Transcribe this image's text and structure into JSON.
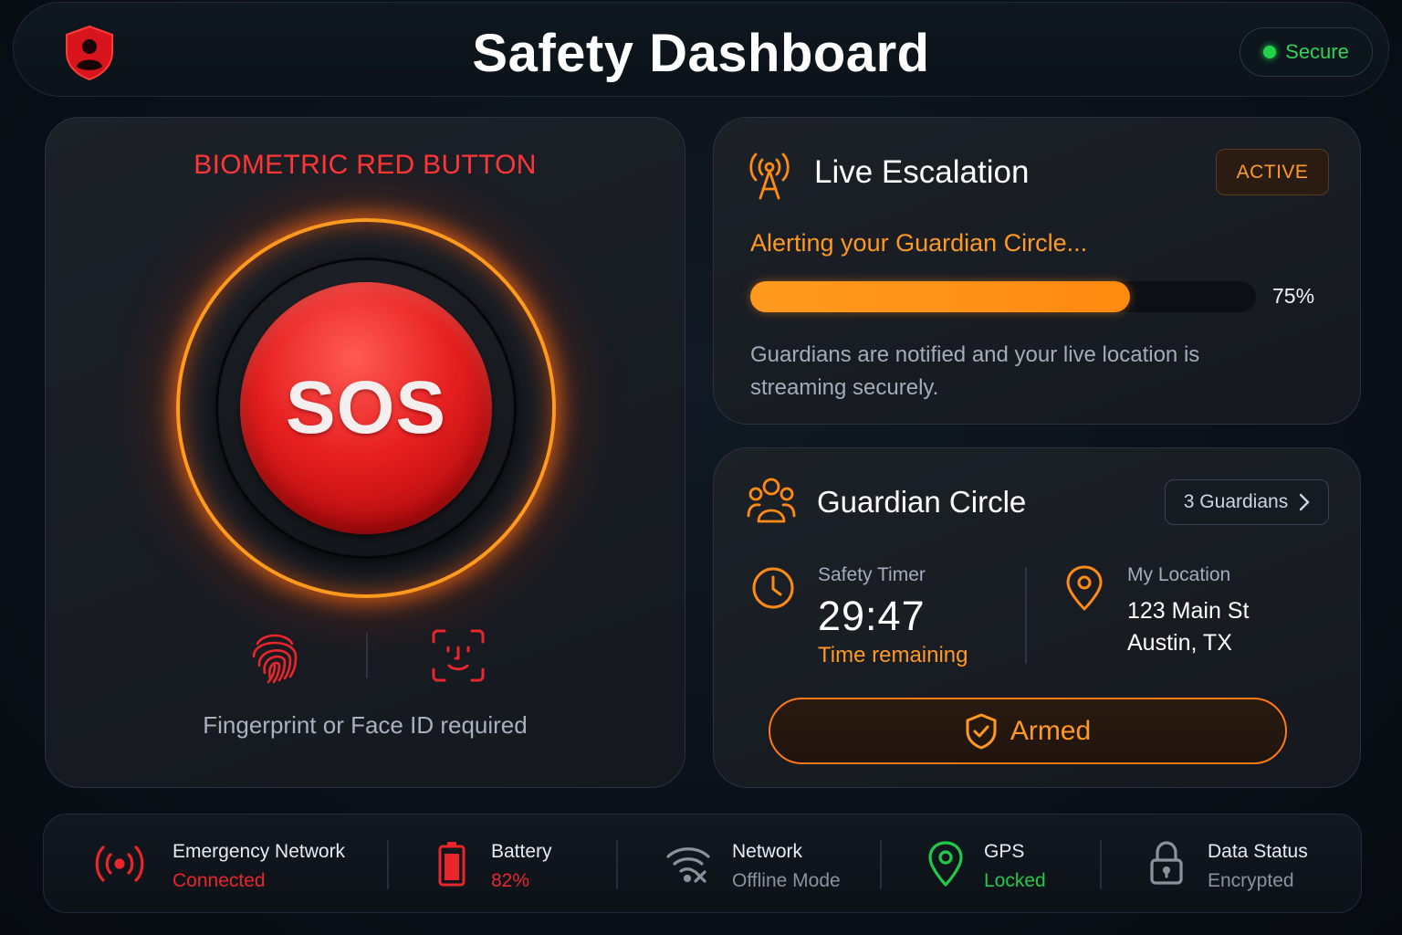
{
  "header": {
    "title": "Safety Dashboard",
    "status": "Secure",
    "logo_icon": "shield-user-icon"
  },
  "sos_panel": {
    "heading": "BIOMETRIC RED BUTTON",
    "button_label": "SOS",
    "caption": "Fingerprint or Face ID required",
    "icons": [
      "fingerprint-icon",
      "face-id-icon"
    ]
  },
  "live_escalation": {
    "title": "Live Escalation",
    "badge": "ACTIVE",
    "alert_text": "Alerting your Guardian Circle...",
    "progress_percent": 75,
    "progress_label": "75%",
    "description": "Guardians are notified and your live location is streaming securely."
  },
  "guardian_circle": {
    "title": "Guardian Circle",
    "guardians_button": "3 Guardians",
    "timer_label": "Safety Timer",
    "timer_value": "29:47",
    "timer_caption": "Time remaining",
    "location_label": "My Location",
    "location_line1": "123 Main St",
    "location_line2": "Austin, TX",
    "armed_label": "Armed"
  },
  "status_bar": {
    "items": [
      {
        "label": "Emergency Network",
        "value": "Connected",
        "color": "#e8262b",
        "icon": "broadcast-icon"
      },
      {
        "label": "Battery",
        "value": "82%",
        "color": "#e8262b",
        "icon": "battery-icon"
      },
      {
        "label": "Network",
        "value": "Offline Mode",
        "color": "#8a929c",
        "icon": "wifi-off-icon"
      },
      {
        "label": "GPS",
        "value": "Locked",
        "color": "#22c84a",
        "icon": "gps-pin-icon"
      },
      {
        "label": "Data Status",
        "value": "Encrypted",
        "color": "#8a929c",
        "icon": "lock-icon"
      }
    ]
  },
  "colors": {
    "accent_orange": "#ff9a1f",
    "alert_red": "#ff3636",
    "secure_green": "#22d34a"
  }
}
